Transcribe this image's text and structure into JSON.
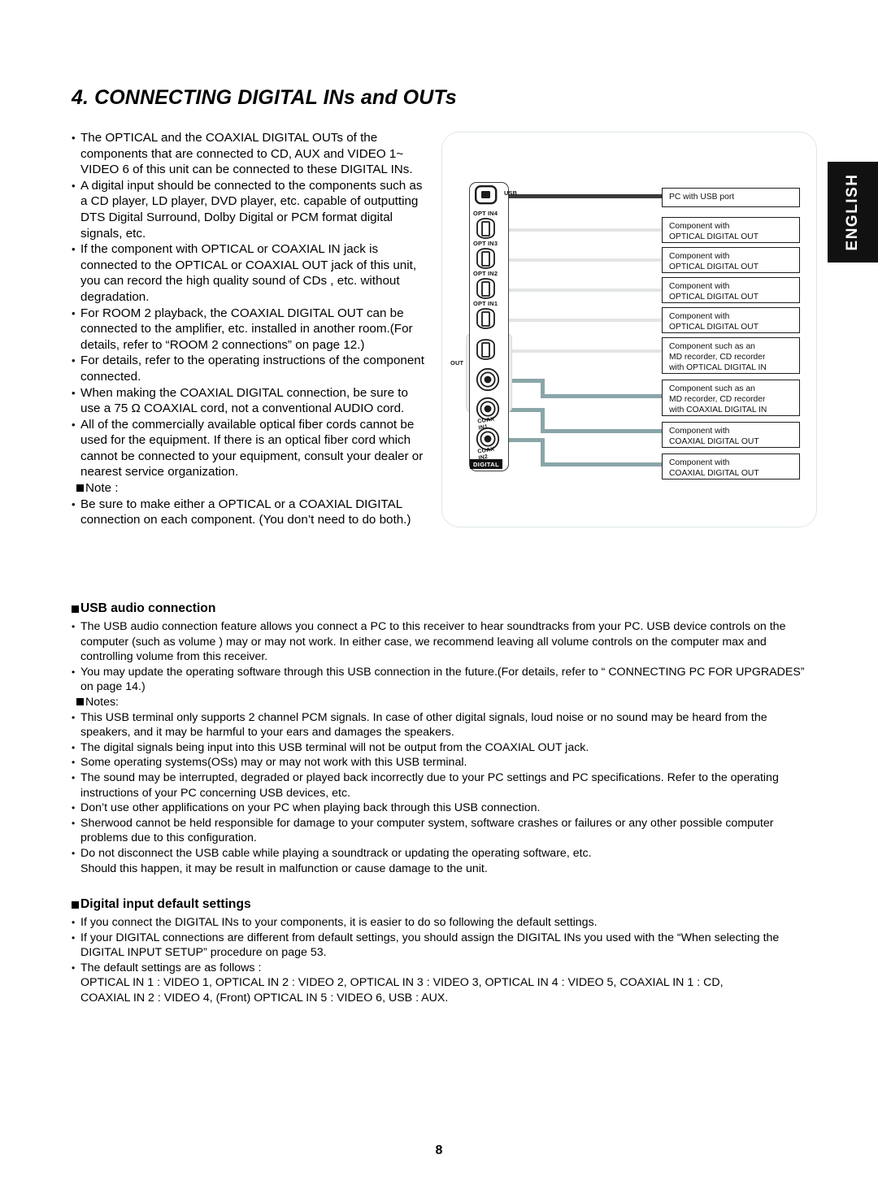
{
  "page": {
    "title": "4. CONNECTING DIGITAL INs and OUTs",
    "number": "8",
    "language_tab": "ENGLISH"
  },
  "colors": {
    "usb_cable": "#3a3a3a",
    "optical_cable": "#e3e5e5",
    "coaxial_cable": "#8aa5a8",
    "tab_background": "#111111",
    "panel_shade": "#eceeee"
  },
  "left_column": {
    "bullets": [
      "The OPTICAL and the COAXIAL DIGITAL OUTs of the components that are connected to CD, AUX and VIDEO 1~ VIDEO 6 of this unit can be connected to these DIGITAL INs.",
      "A digital input should be connected to the components such as a CD player, LD player, DVD player, etc. capable of outputting DTS Digital Surround, Dolby Digital or PCM format digital signals, etc.",
      "If the component with OPTICAL or COAXIAL IN jack is connected to the OPTICAL or COAXIAL OUT jack of this unit, you can record the high quality sound of CDs , etc. without degradation.",
      "For ROOM 2 playback, the COAXIAL DIGITAL OUT can be connected to the amplifier, etc. installed in another room.(For details, refer to “ROOM 2 connections” on page 12.)",
      "For details, refer to the operating instructions of the component connected.",
      "When making the COAXIAL DIGITAL connection, be sure to use a 75 Ω COAXIAL cord, not a conventional AUDIO cord.",
      "All of the commercially available optical fiber cords cannot be used for the equipment. If there is an optical fiber cord which cannot be connected to your equipment, consult your dealer or nearest service organization."
    ],
    "note_heading": "Note :",
    "note_bullets": [
      "Be sure to make either a OPTICAL or a COAXIAL DIGITAL connection on each component. (You don’t need to do both.)"
    ]
  },
  "diagram": {
    "jack_labels": {
      "usb": "USB",
      "opt_in4": "OPT IN4",
      "opt_in3": "OPT IN3",
      "opt_in2": "OPT IN2",
      "opt_in1": "OPT IN1",
      "out": "OUT",
      "coax_in1_line1": "COAX",
      "coax_in1_line2": "IN1",
      "coax_in2_line1": "COAX",
      "coax_in2_line2": "IN2",
      "digital": "DIGITAL"
    },
    "components": [
      {
        "lines": [
          "PC with USB port"
        ]
      },
      {
        "lines": [
          "Component with",
          "OPTICAL DIGITAL OUT"
        ]
      },
      {
        "lines": [
          "Component with",
          "OPTICAL DIGITAL OUT"
        ]
      },
      {
        "lines": [
          "Component with",
          "OPTICAL DIGITAL OUT"
        ]
      },
      {
        "lines": [
          "Component with",
          "OPTICAL DIGITAL OUT"
        ]
      },
      {
        "lines": [
          "Component such as an",
          "MD recorder, CD recorder",
          "with OPTICAL DIGITAL IN"
        ]
      },
      {
        "lines": [
          "Component such as an",
          "MD recorder, CD recorder",
          "with COAXIAL DIGITAL IN"
        ]
      },
      {
        "lines": [
          "Component with",
          "COAXIAL DIGITAL OUT"
        ]
      },
      {
        "lines": [
          "Component with",
          "COAXIAL DIGITAL OUT"
        ]
      }
    ]
  },
  "usb_section": {
    "heading": "USB audio connection",
    "bullets": [
      "The USB audio connection feature allows you connect a PC to this receiver to hear soundtracks from your PC. USB device controls on the computer (such as volume ) may or may not work. In either case, we recommend leaving all volume controls on the computer max and controlling volume from this receiver.",
      "You may update the operating software through this USB connection in the future.(For details, refer to “ CONNECTING PC FOR UPGRADES” on page 14.)"
    ],
    "notes_heading": "Notes:",
    "notes": [
      "This USB terminal only supports 2 channel PCM signals. In case of other digital signals, loud noise or no sound may be heard from the speakers, and it may be harmful to your ears and damages the speakers.",
      "The digital signals being input into this USB terminal will not be output from the COAXIAL OUT jack.",
      "Some operating systems(OSs) may or may not work with this USB terminal.",
      "The sound may be interrupted, degraded or played back incorrectly due to your PC settings and PC specifications. Refer to the operating instructions of your PC concerning USB devices, etc.",
      "Don’t use other applifications on your PC when playing back through this USB connection.",
      "Sherwood cannot be held responsible for damage to your computer system, software crashes or failures or any other possible computer problems due to this configuration.",
      "Do not disconnect the USB cable while playing a soundtrack or updating the operating software, etc."
    ],
    "trailing_line": "Should this happen, it may be result in malfunction or cause damage to the unit."
  },
  "default_settings_section": {
    "heading": "Digital input default settings",
    "bullets": [
      "If you connect the DIGITAL INs to your components, it is easier to do so following the default settings.",
      "If your DIGITAL  connections are different from default settings, you should assign the DIGITAL INs you used with the “When selecting the DIGITAL INPUT SETUP” procedure on page 53.",
      "The default settings are as follows :"
    ],
    "defaults_line1": "OPTICAL IN 1 : VIDEO 1, OPTICAL IN 2 : VIDEO 2, OPTICAL IN 3 : VIDEO 3, OPTICAL IN 4 : VIDEO 5, COAXIAL IN 1 : CD,",
    "defaults_line2": "COAXIAL IN 2 : VIDEO 4, (Front) OPTICAL IN 5 : VIDEO 6, USB : AUX."
  }
}
